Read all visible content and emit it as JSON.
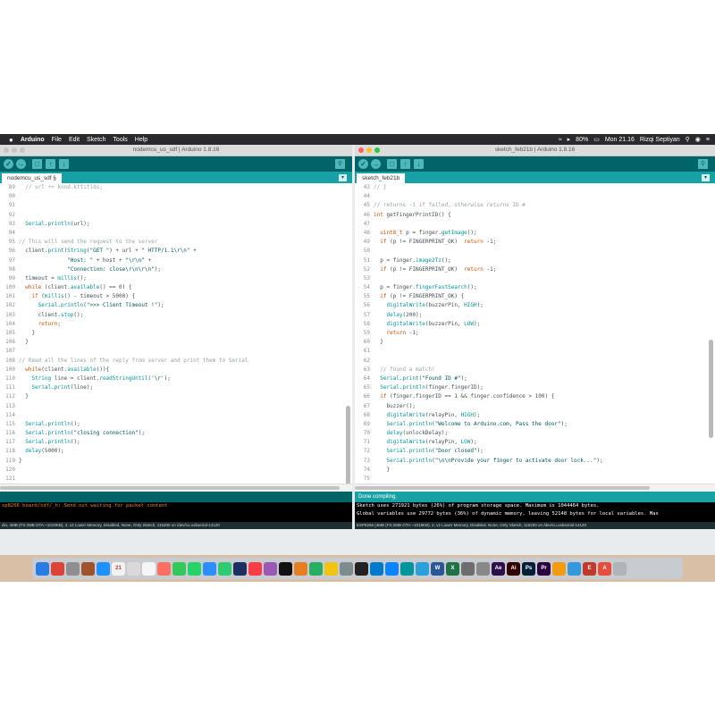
{
  "menubar": {
    "apple_icon": "apple-icon",
    "items": [
      "Arduino",
      "File",
      "Edit",
      "Sketch",
      "Tools",
      "Help"
    ],
    "battery": "80%",
    "clock": "Mon 21.16",
    "user": "Rizqi Septiyan"
  },
  "left_window": {
    "title": "nodemcu_us_sdf | Arduino 1.8.16",
    "tab": "nodemcu_us_sdf §",
    "status": "",
    "console": [
      "sp8266 board/sdf/_h: Send out waiting for packet content"
    ],
    "bottom": "dio, 4MB (FS:2MB OTA:~1019KB), 2, v2 Lower Memory, Disabled, None, Only Sketch, 115200 on /dev/cu.usbserial-14120",
    "code": [
      {
        "n": "89",
        "html": "  <span class=\"c\">// url += kond.kttitids;</span>"
      },
      {
        "n": "90",
        "html": ""
      },
      {
        "n": "91",
        "html": ""
      },
      {
        "n": "92",
        "html": ""
      },
      {
        "n": "93",
        "html": "  <span class=\"t\">Serial</span>.<span class=\"t\">println</span>(url);"
      },
      {
        "n": "94",
        "html": ""
      },
      {
        "n": "95",
        "html": "<span class=\"c\">// This will send the request to the server</span>"
      },
      {
        "n": "96",
        "html": "  client.<span class=\"t\">print</span>(<span class=\"t\">String</span>(<span class=\"s\">\"GET \"</span>) + url + <span class=\"s\">\" HTTP/1.1\\r\\n\"</span> +"
      },
      {
        "n": "97",
        "html": "               <span class=\"s\">\"Host: \"</span> + host + <span class=\"s\">\"\\r\\n\"</span> +"
      },
      {
        "n": "98",
        "html": "               <span class=\"s\">\"Connection: close\\r\\n\\r\\n\"</span>);"
      },
      {
        "n": "99",
        "html": "  timeout = <span class=\"t\">millis</span>();"
      },
      {
        "n": "100",
        "html": "  <span class=\"k\">while</span> (client.<span class=\"t\">available</span>() == 0) {"
      },
      {
        "n": "101",
        "html": "    <span class=\"k\">if</span> (<span class=\"t\">millis</span>() - timeout > 5000) {"
      },
      {
        "n": "102",
        "html": "      <span class=\"t\">Serial</span>.<span class=\"t\">println</span>(<span class=\"s\">\">>> Client Timeout !\"</span>);"
      },
      {
        "n": "103",
        "html": "      client.<span class=\"t\">stop</span>();"
      },
      {
        "n": "104",
        "html": "      <span class=\"k\">return</span>;"
      },
      {
        "n": "105",
        "html": "    }"
      },
      {
        "n": "106",
        "html": "  }"
      },
      {
        "n": "107",
        "html": ""
      },
      {
        "n": "108",
        "html": "<span class=\"c\">// Read all the lines of the reply from server and print them to Serial</span>"
      },
      {
        "n": "109",
        "html": "  <span class=\"k\">while</span>(client.<span class=\"t\">available</span>()){"
      },
      {
        "n": "110",
        "html": "    <span class=\"t\">String</span> line = client.<span class=\"t\">readStringUntil</span>(<span class=\"s\">'\\r'</span>);"
      },
      {
        "n": "111",
        "html": "    <span class=\"t\">Serial</span>.<span class=\"t\">print</span>(line);"
      },
      {
        "n": "112",
        "html": "  }"
      },
      {
        "n": "113",
        "html": ""
      },
      {
        "n": "114",
        "html": ""
      },
      {
        "n": "115",
        "html": "  <span class=\"t\">Serial</span>.<span class=\"t\">println</span>();"
      },
      {
        "n": "116",
        "html": "  <span class=\"t\">Serial</span>.<span class=\"t\">println</span>(<span class=\"s\">\"closing connection\"</span>);"
      },
      {
        "n": "117",
        "html": "  <span class=\"t\">Serial</span>.<span class=\"t\">println</span>();"
      },
      {
        "n": "118",
        "html": "  <span class=\"t\">delay</span>(5000);"
      },
      {
        "n": "119",
        "html": "}"
      },
      {
        "n": "120",
        "html": ""
      },
      {
        "n": "121",
        "html": ""
      },
      {
        "n": "122",
        "html": ""
      },
      {
        "n": "123",
        "html": ""
      }
    ]
  },
  "right_window": {
    "title": "sketch_feb21b | Arduino 1.8.16",
    "tab": "sketch_feb21b",
    "status": "Done compiling.",
    "console": [
      "Sketch uses 271921 bytes (26%) of program storage space. Maximum is 1044464 bytes.",
      "Global variables use 29772 bytes (36%) of dynamic memory, leaving 52148 bytes for local variables. Max"
    ],
    "bottom": "ESP8266 (4MB (FS:2MB OTA:~1019KB), 2, v2 Lower Memory, Disabled, None, Only Sketch, 115200 on /dev/cu.usbserial-14120",
    "code": [
      {
        "n": "43",
        "html": "<span class=\"c\">// }</span>"
      },
      {
        "n": "44",
        "html": ""
      },
      {
        "n": "45",
        "html": "<span class=\"c\">// returns -1 if failed, otherwise returns ID #</span>"
      },
      {
        "n": "46",
        "html": "<span class=\"k\">int</span> getFingerPrintID() {"
      },
      {
        "n": "47",
        "html": ""
      },
      {
        "n": "48",
        "html": "  <span class=\"k\">uint8_t</span> p = finger.<span class=\"t\">getImage</span>();"
      },
      {
        "n": "49",
        "html": "  <span class=\"k\">if</span> (p != FINGERPRINT_OK)  <span class=\"k\">return</span> -1;"
      },
      {
        "n": "50",
        "html": ""
      },
      {
        "n": "51",
        "html": "  p = finger.<span class=\"t\">image2Tz</span>();"
      },
      {
        "n": "52",
        "html": "  <span class=\"k\">if</span> (p != FINGERPRINT_OK)  <span class=\"k\">return</span> -1;"
      },
      {
        "n": "53",
        "html": ""
      },
      {
        "n": "54",
        "html": "  p = finger.<span class=\"t\">fingerFastSearch</span>();"
      },
      {
        "n": "55",
        "html": "  <span class=\"k\">if</span> (p != FINGERPRINT_OK) {"
      },
      {
        "n": "56",
        "html": "    <span class=\"t\">digitalWrite</span>(buzzerPin, <span class=\"t\">HIGH</span>);"
      },
      {
        "n": "57",
        "html": "    <span class=\"t\">delay</span>(200);"
      },
      {
        "n": "58",
        "html": "    <span class=\"t\">digitalWrite</span>(buzzerPin, <span class=\"t\">LOW</span>);"
      },
      {
        "n": "59",
        "html": "    <span class=\"k\">return</span> -1;"
      },
      {
        "n": "60",
        "html": "  }"
      },
      {
        "n": "61",
        "html": ""
      },
      {
        "n": "62",
        "html": ""
      },
      {
        "n": "63",
        "html": "  <span class=\"c\">// found a match!</span>"
      },
      {
        "n": "64",
        "html": "  <span class=\"t\">Serial</span>.<span class=\"t\">print</span>(<span class=\"s\">\"Found ID #\"</span>);"
      },
      {
        "n": "65",
        "html": "  <span class=\"t\">Serial</span>.<span class=\"t\">println</span>(finger.fingerID);"
      },
      {
        "n": "66",
        "html": "  <span class=\"k\">if</span> (finger.fingerID == 1 && finger.confidence > 100) {"
      },
      {
        "n": "67",
        "html": "    buzzer();"
      },
      {
        "n": "68",
        "html": "    <span class=\"t\">digitalWrite</span>(relayPin, <span class=\"t\">HIGH</span>);"
      },
      {
        "n": "69",
        "html": "    <span class=\"t\">Serial</span>.<span class=\"t\">println</span>(<span class=\"s\">\"Welcome to Arduino.com, Pass the door\"</span>);"
      },
      {
        "n": "70",
        "html": "    <span class=\"t\">delay</span>(unlockDelay);"
      },
      {
        "n": "71",
        "html": "    <span class=\"t\">digitalWrite</span>(relayPin, <span class=\"t\">LOW</span>);"
      },
      {
        "n": "72",
        "html": "    <span class=\"t\">Serial</span>.<span class=\"t\">println</span>(<span class=\"s\">\"Door closed\"</span>);"
      },
      {
        "n": "73",
        "html": "    <span class=\"t\">Serial</span>.<span class=\"t\">println</span>(<span class=\"s\">\"\\n\\nProvide your finger to activate door lock...\"</span>);"
      },
      {
        "n": "74",
        "html": "    }"
      },
      {
        "n": "75",
        "html": ""
      },
      {
        "n": "76",
        "html": "  <span class=\"k\">return</span> finger.fingerID;"
      },
      {
        "n": "77",
        "html": "}"
      },
      {
        "n": "78",
        "html": "<span class=\"c\">//</span>"
      },
      {
        "n": "79",
        "html": "<span class=\"k\">void</span> buzzer()"
      },
      {
        "n": "80",
        "html": "{"
      }
    ]
  },
  "dock": {
    "icons": [
      {
        "name": "finder-icon",
        "color": "#2b7be4",
        "glyph": ""
      },
      {
        "name": "chrome-icon",
        "color": "#db4437",
        "glyph": ""
      },
      {
        "name": "launchpad-icon",
        "color": "#8e8e93",
        "glyph": ""
      },
      {
        "name": "app-icon",
        "color": "#a0522d",
        "glyph": ""
      },
      {
        "name": "safari-icon",
        "color": "#1e90ff",
        "glyph": ""
      },
      {
        "name": "calendar-icon",
        "color": "#f2f2f2",
        "glyph": "21"
      },
      {
        "name": "notes-icon",
        "color": "#d9d9d9",
        "glyph": ""
      },
      {
        "name": "reminders-icon",
        "color": "#f5f5f5",
        "glyph": ""
      },
      {
        "name": "photos-icon",
        "color": "#ff6f61",
        "glyph": ""
      },
      {
        "name": "messages-icon",
        "color": "#34c759",
        "glyph": ""
      },
      {
        "name": "whatsapp-icon",
        "color": "#25d366",
        "glyph": ""
      },
      {
        "name": "zoom-icon",
        "color": "#2d8cff",
        "glyph": ""
      },
      {
        "name": "facetime-icon",
        "color": "#2ecc71",
        "glyph": ""
      },
      {
        "name": "ios-icon",
        "color": "#1c2f5e",
        "glyph": ""
      },
      {
        "name": "music-icon",
        "color": "#fc3c44",
        "glyph": ""
      },
      {
        "name": "podcast-icon",
        "color": "#9b59b6",
        "glyph": ""
      },
      {
        "name": "tv-icon",
        "color": "#111111",
        "glyph": ""
      },
      {
        "name": "app-icon-2",
        "color": "#e67e22",
        "glyph": ""
      },
      {
        "name": "app-icon-3",
        "color": "#27ae60",
        "glyph": ""
      },
      {
        "name": "app-icon-4",
        "color": "#f1c40f",
        "glyph": ""
      },
      {
        "name": "preferences-icon",
        "color": "#7f8c8d",
        "glyph": ""
      },
      {
        "name": "terminal-icon",
        "color": "#222222",
        "glyph": ""
      },
      {
        "name": "vscode-icon",
        "color": "#007acc",
        "glyph": ""
      },
      {
        "name": "appstore-icon",
        "color": "#0a84ff",
        "glyph": ""
      },
      {
        "name": "arduino-icon",
        "color": "#00979c",
        "glyph": ""
      },
      {
        "name": "telegram-icon",
        "color": "#2aa1da",
        "glyph": ""
      },
      {
        "name": "word-icon",
        "color": "#2b579a",
        "glyph": "W"
      },
      {
        "name": "excel-icon",
        "color": "#217346",
        "glyph": "X"
      },
      {
        "name": "app-icon-5",
        "color": "#6d6d6d",
        "glyph": ""
      },
      {
        "name": "app-icon-6",
        "color": "#888888",
        "glyph": ""
      },
      {
        "name": "after-effects-icon",
        "color": "#2d0f4c",
        "glyph": "Ae"
      },
      {
        "name": "illustrator-icon",
        "color": "#330000",
        "glyph": "Ai"
      },
      {
        "name": "photoshop-icon",
        "color": "#001e36",
        "glyph": "Ps"
      },
      {
        "name": "premiere-icon",
        "color": "#2a003f",
        "glyph": "Pr"
      },
      {
        "name": "app-icon-7",
        "color": "#f39c12",
        "glyph": ""
      },
      {
        "name": "globe-icon",
        "color": "#3498db",
        "glyph": ""
      },
      {
        "name": "app-icon-8",
        "color": "#c0392b",
        "glyph": "E"
      },
      {
        "name": "app-icon-9",
        "color": "#e74c3c",
        "glyph": "A"
      },
      {
        "name": "trash-icon",
        "color": "#b0b3b8",
        "glyph": ""
      }
    ]
  }
}
